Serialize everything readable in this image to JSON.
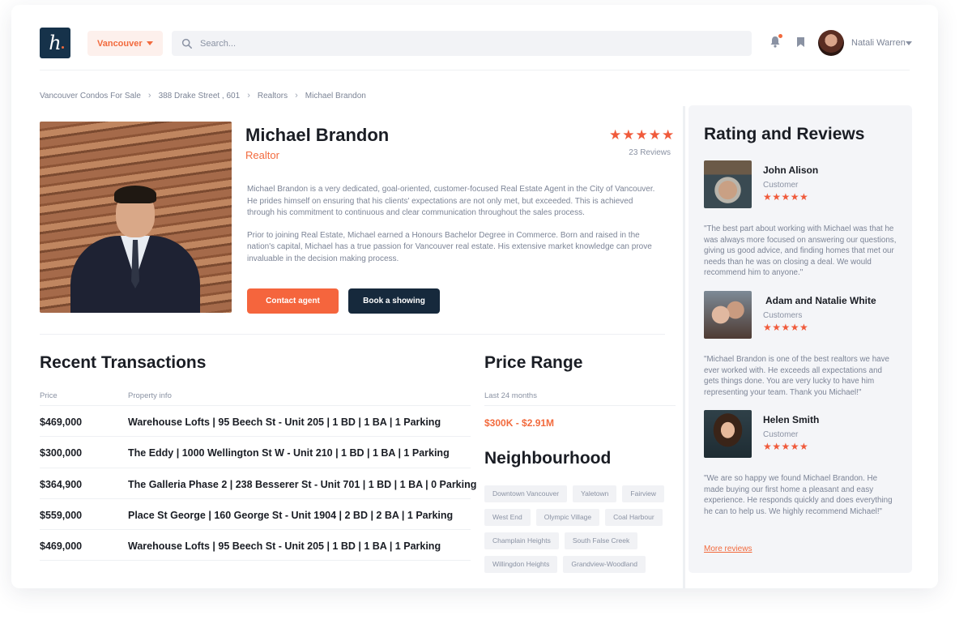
{
  "header": {
    "logo_letter": "h",
    "city": "Vancouver",
    "search_placeholder": "Search...",
    "user_name": "Natali Warren"
  },
  "breadcrumb": [
    "Vancouver Condos For Sale",
    "388 Drake Street , 601",
    "Realtors",
    "Michael Brandon"
  ],
  "agent": {
    "name": "Michael Brandon",
    "role": "Realtor",
    "stars": "★★★★★",
    "reviews": "23 Reviews",
    "bio": [
      "Michael Brandon is a very dedicated, goal-oriented, customer-focused Real Estate Agent in the City of Vancouver. He prides himself on ensuring that his clients' expectations are not only met, but exceeded. This is achieved through his commitment to continuous and clear communication throughout the sales process.",
      "Prior to joining Real Estate, Michael earned a Honours Bachelor Degree in Commerce. Born and raised in the nation's capital, Michael has a true passion for Vancouver real estate. His extensive market knowledge can prove invaluable in the decision making process."
    ],
    "contact_label": "Contact agent",
    "book_label": "Book a showing"
  },
  "transactions": {
    "title": "Recent Transactions",
    "col_price": "Price",
    "col_info": "Property info",
    "rows": [
      {
        "price": "$469,000",
        "info": "Warehouse Lofts   |   95 Beech St - Unit 205   |   1 BD   |   1 BA   |   1 Parking"
      },
      {
        "price": "$300,000",
        "info": "The Eddy | 1000 Wellington St W - Unit 210 | 1 BD | 1 BA | 1 Parking"
      },
      {
        "price": "$364,900",
        "info": "The Galleria Phase 2 | 238 Besserer St - Unit 701 | 1 BD | 1 BA | 0 Parking"
      },
      {
        "price": "$559,000",
        "info": "Place St George | 160 George St - Unit 1904 | 2 BD | 2 BA | 1 Parking"
      },
      {
        "price": "$469,000",
        "info": "Warehouse Lofts   |   95 Beech St - Unit 205   |   1 BD   |   1 BA   |   1 Parking"
      }
    ]
  },
  "price_range": {
    "title": "Price Range",
    "subtitle": "Last 24 months",
    "value": "$300K - $2.91M"
  },
  "neighbourhood": {
    "title": "Neighbourhood",
    "tags": [
      "Downtown Vancouver",
      "Yaletown",
      "Fairview",
      "West End",
      "Olympic Village",
      "Coal Harbour",
      "Champlain Heights",
      "South False Creek",
      "Willingdon Heights",
      "Grandview-Woodland"
    ]
  },
  "reviews": {
    "title": "Rating and Reviews",
    "items": [
      {
        "name": "John Alison",
        "role": "Customer",
        "stars": "★★★★★",
        "text": "\"The best part about working with Michael was that he was always more focused on answering our questions, giving us good advice, and finding homes that met our needs than he was on closing a deal. We would recommend him to anyone.\""
      },
      {
        "name": "Adam and Natalie White",
        "role": "Customers",
        "stars": "★★★★★",
        "text": "\"Michael Brandon is one of the best realtors we have ever worked with. He exceeds all expectations and gets things done. You are very lucky to have him representing your team. Thank you Michael!\""
      },
      {
        "name": "Helen Smith",
        "role": "Customer",
        "stars": "★★★★★",
        "text": "\"We are so happy we found Michael Brandon. He made buying our first home a pleasant and easy experience. He responds quickly and does everything he can to help us. We highly recommend Michael!\""
      }
    ],
    "more_label": "More reviews"
  },
  "colors": {
    "accent": "#f26a3d",
    "dark": "#16293c",
    "star": "#f05a3b"
  },
  "icons": {
    "search": "search-icon",
    "bell": "bell-icon",
    "bookmark": "bookmark-icon"
  }
}
